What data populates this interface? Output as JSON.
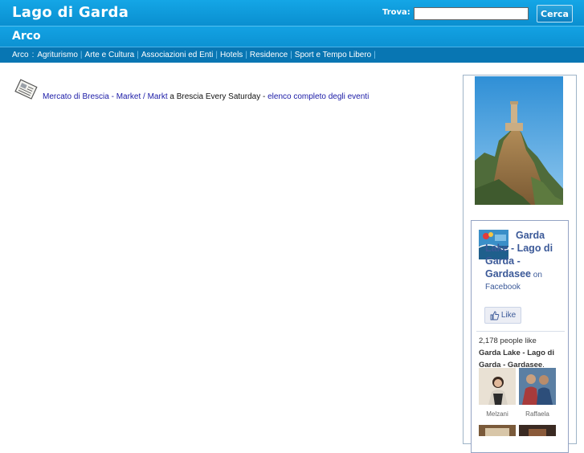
{
  "header": {
    "title": "Lago di Garda",
    "search_label": "Trova:",
    "search_value": "",
    "search_button": "Cerca"
  },
  "subheader": {
    "title": "Arco"
  },
  "nav": {
    "lead": "Arco",
    "lead_sep": ":",
    "items": [
      "Agriturismo",
      "Arte e Cultura",
      "Associazioni ed Enti",
      "Hotels",
      "Residence",
      "Sport e Tempo Libero"
    ]
  },
  "content": {
    "icon": "newspaper-icon",
    "event_link": "Mercato di Brescia - Market / Markt",
    "event_text": " a Brescia Every Saturday - ",
    "all_events_link": "elenco completo degli eventi"
  },
  "sidebar": {
    "photo": "castle-of-arco-photo",
    "facebook": {
      "title": "Garda Lake - Lago di Garda - Gardasee",
      "on": " on",
      "facebook": "Facebook",
      "like": "Like",
      "count_text": "2,178 people like",
      "page_name": "Garda Lake - Lago di Garda - Gardasee",
      "page_suffix": ".",
      "fans": [
        {
          "name": "Melzani"
        },
        {
          "name": "Raffaela"
        }
      ]
    }
  },
  "colors": {
    "header_blue": "#0e97d8",
    "nav_blue": "#0876b3",
    "link_blue": "#1a1aa6",
    "facebook_blue": "#3b5998"
  }
}
